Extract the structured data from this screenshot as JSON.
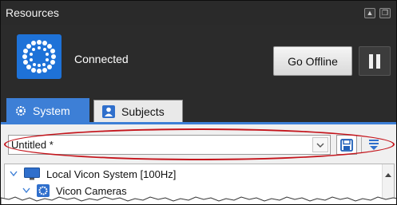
{
  "panel": {
    "title": "Resources",
    "title_buttons": [
      {
        "name": "pin-icon",
        "glyph": "▲"
      },
      {
        "name": "float-window-icon",
        "glyph": "❐"
      }
    ]
  },
  "connection": {
    "status_text": "Connected",
    "go_offline_label": "Go Offline",
    "pause_icon": "pause-icon",
    "logo_icon": "vicon-logo-icon"
  },
  "tabs": [
    {
      "label": "System",
      "icon": "system-gear-icon",
      "active": true
    },
    {
      "label": "Subjects",
      "icon": "subjects-person-icon",
      "active": false
    }
  ],
  "toolbar": {
    "configuration_value": "Untitled *",
    "dropdown_icon": "chevron-down-icon",
    "save_icon": "save-disk-icon",
    "filter_icon": "filter-icon"
  },
  "tree": {
    "items": [
      {
        "label": "Local Vicon System [100Hz]",
        "icon": "monitor-icon",
        "expanded": true
      },
      {
        "label": "Vicon Cameras",
        "icon": "camera-group-icon",
        "expanded": true
      }
    ]
  },
  "colors": {
    "accent_blue": "#3d7fd6",
    "panel_dark": "#2b2b2b",
    "highlight_red": "#c4151c"
  }
}
